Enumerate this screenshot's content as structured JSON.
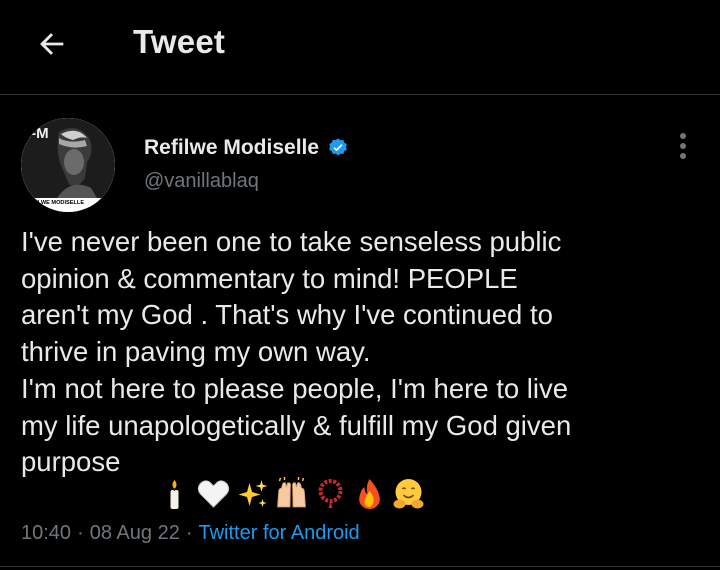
{
  "header": {
    "title": "Tweet",
    "back_icon": "arrow-left-icon"
  },
  "tweet": {
    "author": {
      "name": "Refilwe Modiselle",
      "handle": "@vanillablaq",
      "verified": true,
      "avatar_caption": "REFILWE MODISELLE"
    },
    "text": "I've never been one to take senseless public\nopinion & commentary to mind! PEOPLE\naren't my God . That's why I've continued to\nthrive in paving my own way.\nI'm not here to please people, I'm here to live\nmy life unapologetically & fulfill my God given\npurpose",
    "emojis": [
      "candle",
      "white-heart",
      "sparkles",
      "raising-hands",
      "prayer-beads",
      "fire",
      "hugging-face"
    ],
    "time": "10:40",
    "date": "08 Aug 22",
    "source": "Twitter for Android"
  },
  "colors": {
    "background": "#000000",
    "text": "#e7e9ea",
    "secondary": "#71767b",
    "link": "#1d9bf0",
    "divider": "#2f3336"
  }
}
